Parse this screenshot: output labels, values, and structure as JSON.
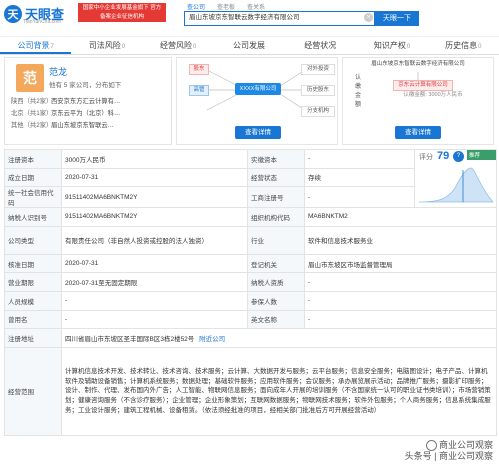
{
  "header": {
    "logo_text": "天眼查",
    "logo_mark": "天",
    "logo_sub": "TianYanCha.com",
    "gov_badge": "国家中小企业发展基金旗下 官方备案企业征信机构",
    "search_tabs": [
      "查公司",
      "查老板",
      "查关系"
    ],
    "search_value": "眉山东坡京东智联云数字经济有限公司",
    "search_button": "天眼一下"
  },
  "nav": [
    {
      "label": "公司背景",
      "count": "7",
      "active": true
    },
    {
      "label": "司法风险",
      "count": "0",
      "active": false
    },
    {
      "label": "经营风险",
      "count": "0",
      "active": false
    },
    {
      "label": "公司发展",
      "count": "",
      "active": false
    },
    {
      "label": "经营状况",
      "count": "",
      "active": false
    },
    {
      "label": "知识产权",
      "count": "0",
      "active": false
    },
    {
      "label": "历史信息",
      "count": "0",
      "active": false
    }
  ],
  "person": {
    "avatar": "范",
    "name": "范龙",
    "desc": "他有 5 家公司，分布如下",
    "relations": [
      {
        "label": "陕西（共2家）",
        "value": "西安京东方汇云计算有…"
      },
      {
        "label": "北京（共1家）",
        "value": "京东云平为（北京）科…"
      },
      {
        "label": "其他（共2家）",
        "value": "眉山东坡京东智联云…"
      }
    ]
  },
  "graph": {
    "nodes": [
      "股东",
      "高管",
      "XXXX有限公司",
      "对外投资",
      "历史股东",
      "分支机构"
    ],
    "button": "查看详情"
  },
  "equity": {
    "top": "眉山东坡京东智联云数字经济有限公司",
    "shareholder": "京东云计算有限公司",
    "small1": "认缴金额",
    "small2": "认缴金额: 3000万人民币",
    "button": "查看详情"
  },
  "score": {
    "label": "评分",
    "value": "79",
    "badge": "认证报告推荐"
  },
  "info": {
    "reg_capital_k": "注册资本",
    "reg_capital_v": "3000万人民币",
    "paid_capital_k": "实缴资本",
    "paid_capital_v": "-",
    "founded_k": "成立日期",
    "founded_v": "2020-07-31",
    "status_k": "经营状态",
    "status_v": "存续",
    "credit_code_k": "统一社会信用代码",
    "credit_code_v": "91511402MA6BNKTM2Y",
    "biz_reg_k": "工商注册号",
    "biz_reg_v": "-",
    "taxpayer_id_k": "纳税人识别号",
    "taxpayer_id_v": "91511402MA6BNKTM2Y",
    "org_code_k": "组织机构代码",
    "org_code_v": "MA6BNKTM2",
    "company_type_k": "公司类型",
    "company_type_v": "有限责任公司（非自然人投资或控股的法人独资）",
    "industry_k": "行业",
    "industry_v": "软件和信息技术服务业",
    "approval_k": "核准日期",
    "approval_v": "2020-07-31",
    "authority_k": "登记机关",
    "authority_v": "眉山市东坡区市场监督管理局",
    "term_k": "营业期限",
    "term_v": "2020-07-31至无固定期限",
    "taxpayer_q_k": "纳税人资质",
    "taxpayer_q_v": "-",
    "staff_k": "人员规模",
    "staff_v": "-",
    "insured_k": "参保人数",
    "insured_v": "-",
    "former_k": "曾用名",
    "former_v": "-",
    "english_k": "英文名称",
    "english_v": "-",
    "address_k": "注册地址",
    "address_v": "四川省眉山市东坡区圣丰国际B区3栋2楼52号",
    "address_link": "附近公司",
    "scope_k": "经营范围",
    "scope_v": "计算机信息技术开发、技术转让、技术咨询、技术服务；云计算、大数据开发与服务；云平台服务；信息安全服务；电脑图设计；电子产品、计算机软件及辅助设备销售；计算机系统服务；数据处理；基础软件服务；应用软件服务；会议服务；承办展览展示活动；品牌推广服务；摄影扩印服务；设计、制作、代理、发布国内外广告；人工智能、物联网信息服务；面向成年人开展的培训服务（不含国家统一认可的职业证书类培训）；市场营销策划；健康咨询服务（不含诊疗服务）；企业管理；企业形象策划；互联网数据服务；物联网技术服务；软件外包服务；个人商务服务；信息系统集成服务；工业设计服务；建筑工程机械、设备租赁。（依法须经批准的项目，经相关部门批准后方可开展经营活动）"
  },
  "watermark": {
    "line1": "商业公司观察",
    "line2": "头条号 | 商业公司观察"
  }
}
